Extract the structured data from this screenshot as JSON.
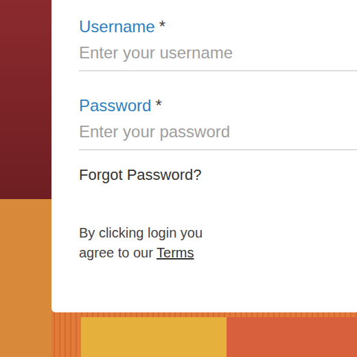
{
  "form": {
    "fields": [
      {
        "label": "Username",
        "required_mark": "*",
        "placeholder": "Enter your username",
        "kind": "text"
      },
      {
        "label": "Password",
        "required_mark": "*",
        "placeholder": "Enter your password",
        "kind": "password"
      }
    ],
    "forgot_link": "Forgot Password?",
    "terms": {
      "text": "By clicking login you agree to our",
      "link": "Terms"
    }
  }
}
